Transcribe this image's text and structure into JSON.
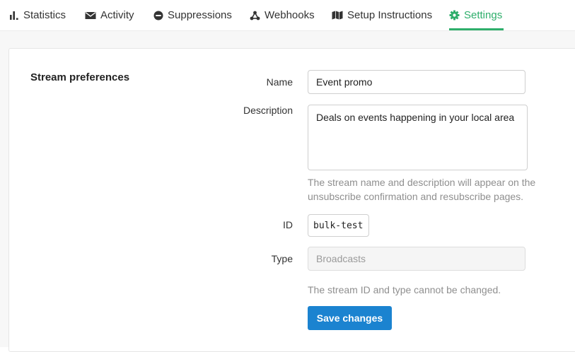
{
  "colors": {
    "accent": "#2eae6b",
    "primary_button": "#1b83d0",
    "help_text": "#8f8f8f"
  },
  "tabs": [
    {
      "label": "Statistics",
      "icon": "bar-chart-icon",
      "active": false
    },
    {
      "label": "Activity",
      "icon": "envelope-icon",
      "active": false
    },
    {
      "label": "Suppressions",
      "icon": "minus-circle-icon",
      "active": false
    },
    {
      "label": "Webhooks",
      "icon": "webhooks-icon",
      "active": false
    },
    {
      "label": "Setup Instructions",
      "icon": "map-icon",
      "active": false
    },
    {
      "label": "Settings",
      "icon": "gear-icon",
      "active": true
    }
  ],
  "settings": {
    "section_title": "Stream preferences",
    "name_label": "Name",
    "name_value": "Event promo",
    "description_label": "Description",
    "description_value": "Deals on events happening in your local area",
    "description_help": "The stream name and description will appear on the unsubscribe confirmation and resubscribe pages.",
    "id_label": "ID",
    "id_value": "bulk-test",
    "type_label": "Type",
    "type_value": "Broadcasts",
    "type_help": "The stream ID and type cannot be changed.",
    "save_label": "Save changes"
  }
}
